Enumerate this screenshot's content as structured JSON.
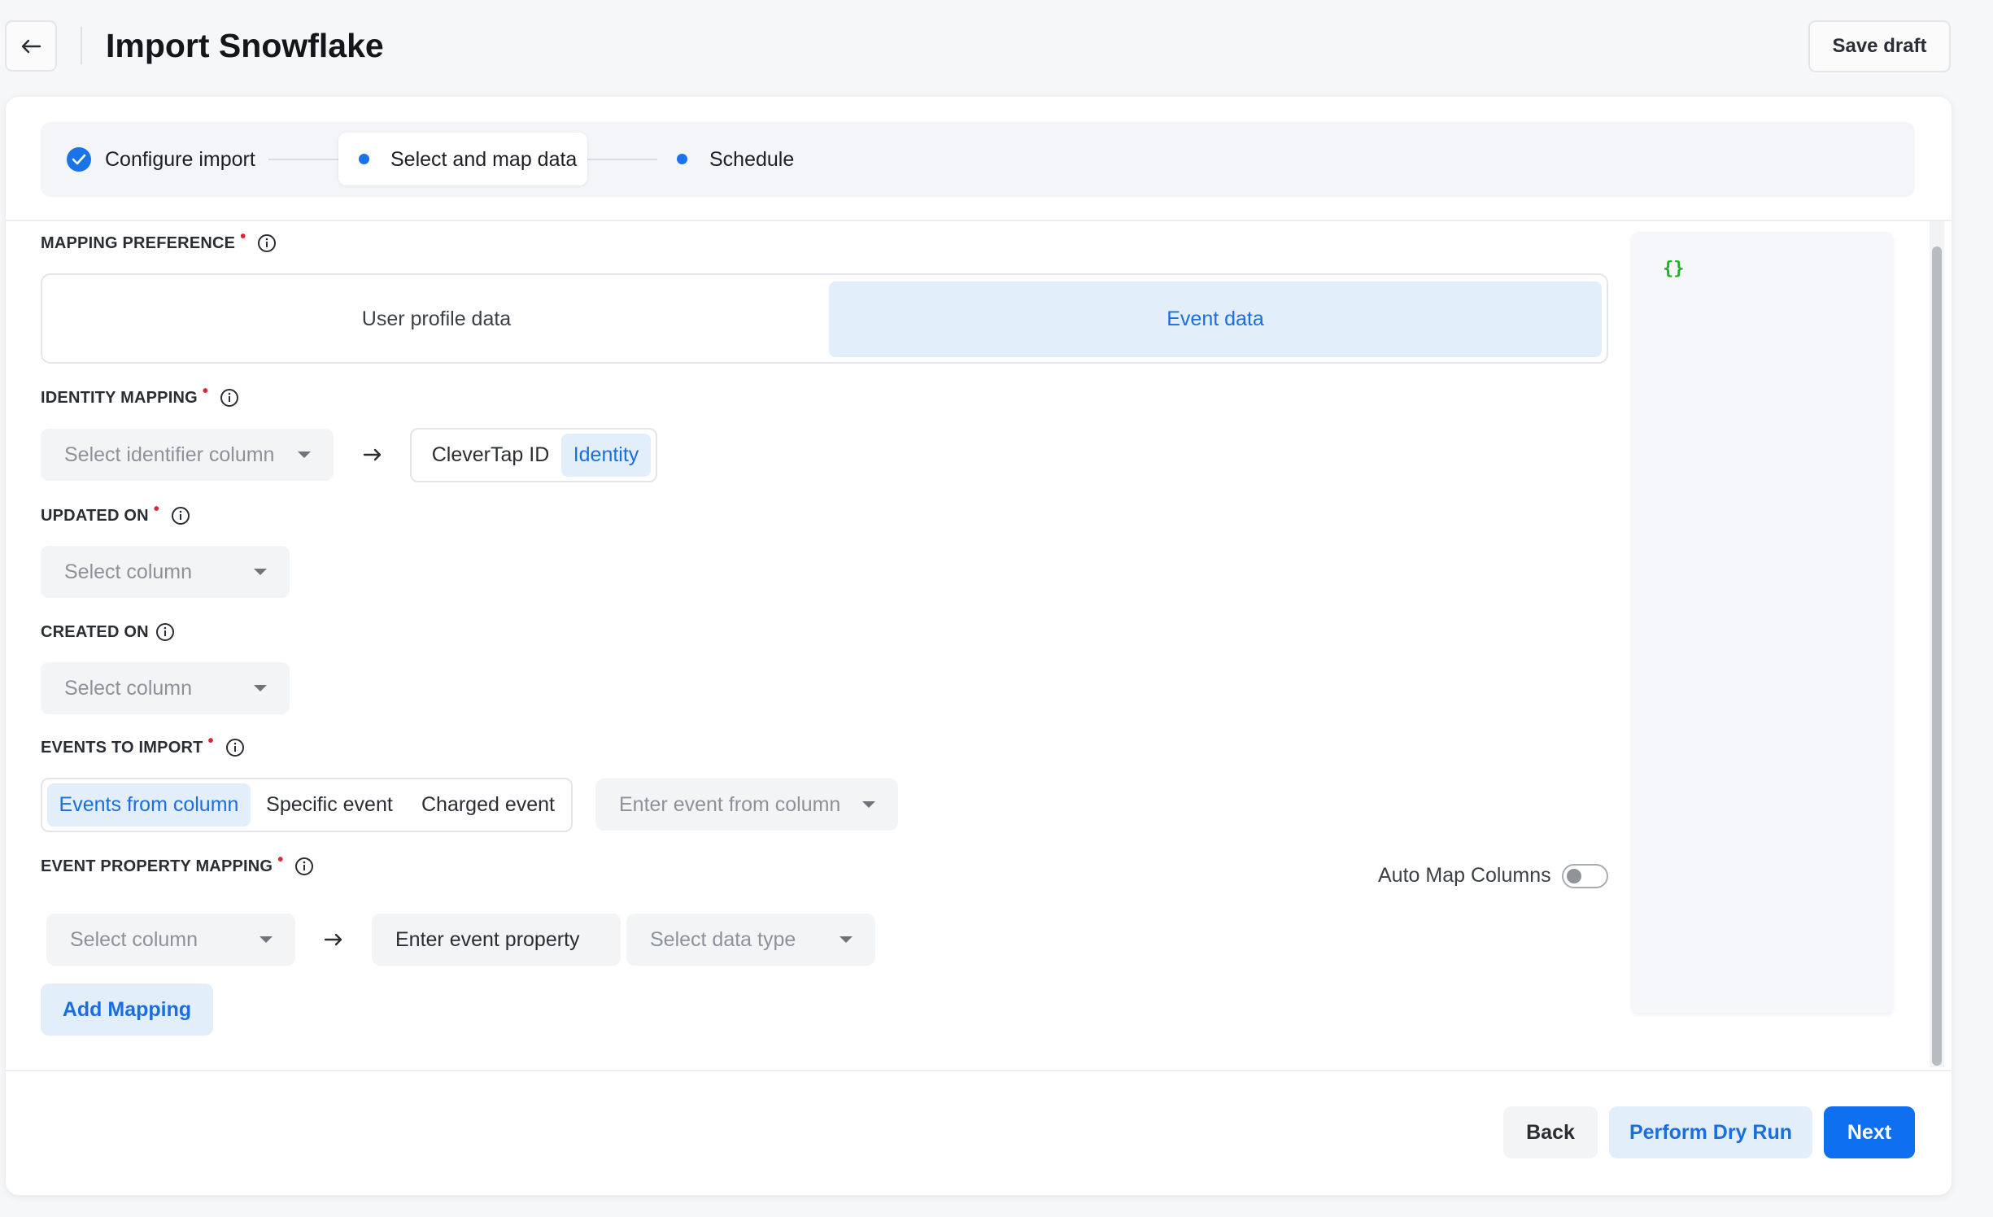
{
  "header": {
    "title": "Import Snowflake",
    "save_draft_label": "Save draft"
  },
  "stepper": {
    "steps": [
      {
        "label": "Configure import",
        "state": "completed"
      },
      {
        "label": "Select and map data",
        "state": "active"
      },
      {
        "label": "Schedule",
        "state": "pending"
      }
    ]
  },
  "mapping_preference": {
    "label": "MAPPING PREFERENCE",
    "required": "•",
    "options": [
      "User profile data",
      "Event data"
    ],
    "selected": "Event data"
  },
  "identity_mapping": {
    "label": "IDENTITY MAPPING",
    "required": "•",
    "column_placeholder": "Select identifier column",
    "target_options": [
      "CleverTap ID",
      "Identity"
    ],
    "selected_target": "Identity"
  },
  "updated_on": {
    "label": "UPDATED ON",
    "required": "•",
    "placeholder": "Select column"
  },
  "created_on": {
    "label": "CREATED ON",
    "placeholder": "Select column"
  },
  "events_to_import": {
    "label": "EVENTS TO IMPORT",
    "required": "•",
    "options": [
      "Events from column",
      "Specific event",
      "Charged event"
    ],
    "selected": "Events from column",
    "event_column_placeholder": "Enter event from column"
  },
  "event_property_mapping": {
    "label": "EVENT PROPERTY MAPPING",
    "required": "•",
    "auto_map_label": "Auto Map Columns",
    "auto_map_enabled": false,
    "column_placeholder": "Select column",
    "property_placeholder": "Enter event property",
    "data_type_placeholder": "Select data type",
    "add_mapping_label": "Add Mapping"
  },
  "preview": {
    "json_text": "{}"
  },
  "footer": {
    "back_label": "Back",
    "dry_run_label": "Perform Dry Run",
    "next_label": "Next"
  },
  "colors": {
    "accent": "#1a73e8",
    "accent_light": "#e3eefb",
    "required": "#e0243a",
    "json_text": "#20b020"
  }
}
